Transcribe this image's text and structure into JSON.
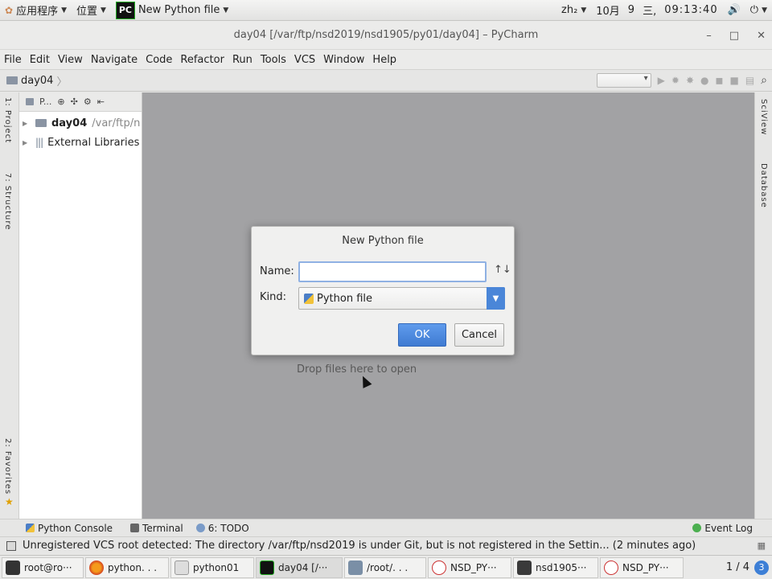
{
  "top_panel": {
    "applications": "应用程序",
    "places": "位置",
    "app_icon_text": "PC",
    "active_window": "New Python file",
    "input_method": "zh₂",
    "month": "10月",
    "day": "9",
    "weekday": "三,",
    "time": "09:13:40"
  },
  "window": {
    "title": "day04 [/var/ftp/nsd2019/nsd1905/py01/day04] – PyCharm"
  },
  "menu": [
    "File",
    "Edit",
    "View",
    "Navigate",
    "Code",
    "Refactor",
    "Run",
    "Tools",
    "VCS",
    "Window",
    "Help"
  ],
  "nav": {
    "breadcrumb": "day04"
  },
  "left_strip": {
    "project_tab": "1: Project",
    "structure_tab": "7: Structure",
    "favorites_tab": "2: Favorites"
  },
  "project": {
    "header": "P...",
    "items": [
      {
        "name": "day04",
        "path": "/var/ftp/n"
      },
      {
        "name": "External Libraries"
      }
    ]
  },
  "editor": {
    "drop_hint": "Drop files here to open"
  },
  "right_strip": {
    "scview_tab": "SciView",
    "database_tab": "Database"
  },
  "dialog": {
    "title": "New Python file",
    "name_label": "Name:",
    "name_value": "",
    "kind_label": "Kind:",
    "kind_value": "Python file",
    "ok": "OK",
    "cancel": "Cancel"
  },
  "bottom_tabs": {
    "python_console": "Python Console",
    "terminal": "Terminal",
    "todo": "6: TODO",
    "event_log": "Event Log"
  },
  "status": {
    "message": "Unregistered VCS root detected: The directory /var/ftp/nsd2019 is under Git, but is not registered in the Settin... (2 minutes ago)"
  },
  "taskbar": {
    "items": [
      "root@ro···",
      "python. . .",
      "python01",
      "day04 [/···",
      "/root/. . .",
      "NSD_PY···",
      "nsd1905···",
      "NSD_PY···"
    ],
    "pager": "1 / 4",
    "workspace_badge": "3"
  },
  "colors": {
    "accent": "#4a86d8",
    "editor_bg": "#a2a2a4",
    "ok_button": "#4f8ce0"
  }
}
